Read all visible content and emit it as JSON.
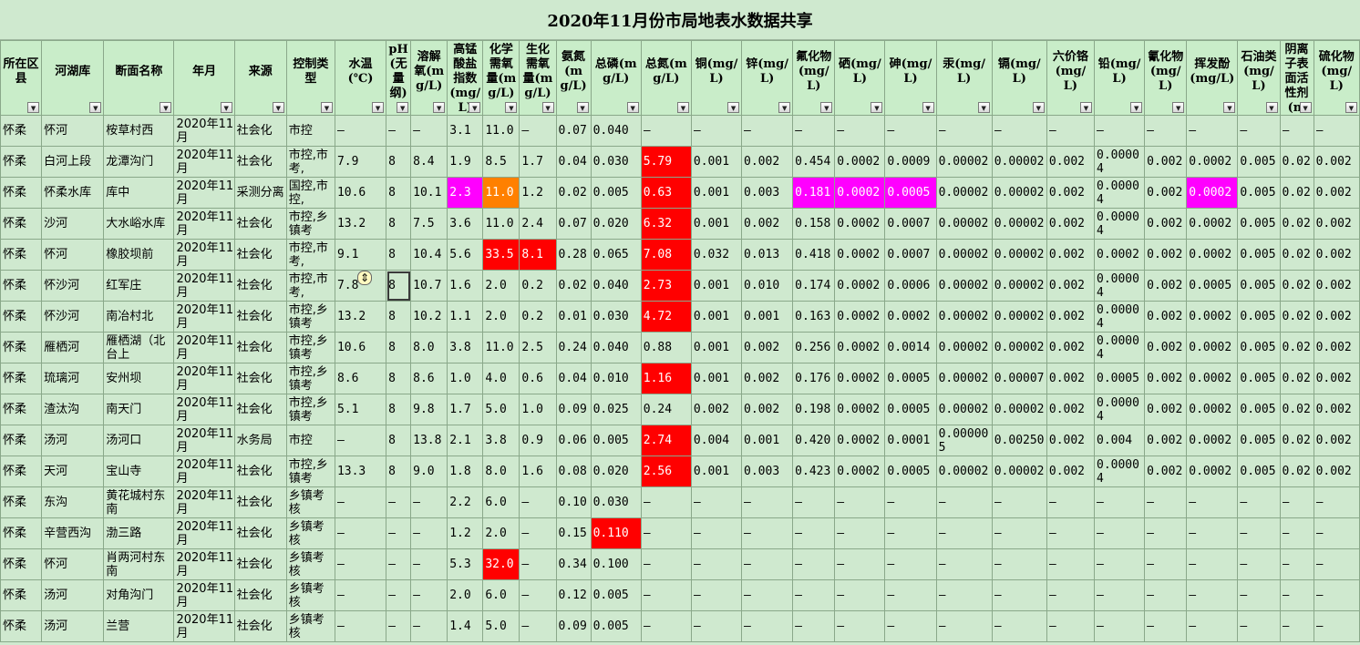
{
  "title": "2020年11月份市局地表水数据共享",
  "columns": [
    {
      "label": "所在区县",
      "width": 45
    },
    {
      "label": "河湖库",
      "width": 68
    },
    {
      "label": "断面名称",
      "width": 77
    },
    {
      "label": "年月",
      "width": 66
    },
    {
      "label": "来源",
      "width": 57
    },
    {
      "label": "控制类型",
      "width": 53
    },
    {
      "label": "水温(℃)",
      "width": 56
    },
    {
      "label": "pH(无量纲)",
      "width": 27
    },
    {
      "label": "溶解氧(mg/L)",
      "width": 40
    },
    {
      "label": "高锰酸盐指数(mg/L)",
      "width": 39
    },
    {
      "label": "化学需氧量(mg/L)",
      "width": 40
    },
    {
      "label": "生化需氧量(mg/L)",
      "width": 40
    },
    {
      "label": "氨氮(mg/L)",
      "width": 38
    },
    {
      "label": "总磷(mg/L)",
      "width": 55
    },
    {
      "label": "总氮(mg/L)",
      "width": 55
    },
    {
      "label": "铜(mg/L)",
      "width": 55
    },
    {
      "label": "锌(mg/L)",
      "width": 56
    },
    {
      "label": "氟化物(mg/L)",
      "width": 46
    },
    {
      "label": "硒(mg/L)",
      "width": 55
    },
    {
      "label": "砷(mg/L)",
      "width": 56
    },
    {
      "label": "汞(mg/L)",
      "width": 61
    },
    {
      "label": "镉(mg/L)",
      "width": 60
    },
    {
      "label": "六价铬(mg/L)",
      "width": 52
    },
    {
      "label": "铅(mg/L)",
      "width": 55
    },
    {
      "label": "氰化物(mg/L)",
      "width": 46
    },
    {
      "label": "挥发酚(mg/L)",
      "width": 56
    },
    {
      "label": "石油类(mg/L)",
      "width": 46
    },
    {
      "label": "阴离子表面活性剂(mg/L)",
      "width": 37
    },
    {
      "label": "硫化物(mg/L)",
      "width": 50
    }
  ],
  "filter_icon": "dropdown-arrow-icon",
  "highlight_colors": {
    "red": "#ff0000",
    "magenta": "#ff00ff",
    "orange": "#ff8000"
  },
  "rows": [
    {
      "cells": [
        "怀柔",
        "怀河",
        "桉草村西",
        "2020年11月",
        "社会化",
        "市控",
        "–",
        "–",
        "–",
        "3.1",
        "11.0",
        "–",
        "0.07",
        "0.040",
        "–",
        "–",
        "–",
        "–",
        "–",
        "–",
        "–",
        "–",
        "–",
        "–",
        "–",
        "–",
        "–",
        "–",
        "–"
      ],
      "hl": {}
    },
    {
      "cells": [
        "怀柔",
        "白河上段",
        "龙潭沟门",
        "2020年11月",
        "社会化",
        "市控,市考,",
        "7.9",
        "8",
        "8.4",
        "1.9",
        "8.5",
        "1.7",
        "0.04",
        "0.030",
        "5.79",
        "0.001",
        "0.002",
        "0.454",
        "0.0002",
        "0.0009",
        "0.00002",
        "0.00002",
        "0.002",
        "0.00004",
        "0.002",
        "0.0002",
        "0.005",
        "0.02",
        "0.002"
      ],
      "hl": {
        "14": "red"
      }
    },
    {
      "cells": [
        "怀柔",
        "怀柔水库",
        "库中",
        "2020年11月",
        "采测分离",
        "国控,市控,",
        "10.6",
        "8",
        "10.1",
        "2.3",
        "11.0",
        "1.2",
        "0.02",
        "0.005",
        "0.63",
        "0.001",
        "0.003",
        "0.181",
        "0.0002",
        "0.0005",
        "0.00002",
        "0.00002",
        "0.002",
        "0.00004",
        "0.002",
        "0.0002",
        "0.005",
        "0.02",
        "0.002"
      ],
      "hl": {
        "9": "mag",
        "10": "org",
        "14": "red",
        "17": "mag",
        "18": "mag",
        "19": "mag",
        "25": "mag"
      }
    },
    {
      "cells": [
        "怀柔",
        "沙河",
        "大水峪水库",
        "2020年11月",
        "社会化",
        "市控,乡镇考",
        "13.2",
        "8",
        "7.5",
        "3.6",
        "11.0",
        "2.4",
        "0.07",
        "0.020",
        "6.32",
        "0.001",
        "0.002",
        "0.158",
        "0.0002",
        "0.0007",
        "0.00002",
        "0.00002",
        "0.002",
        "0.00004",
        "0.002",
        "0.0002",
        "0.005",
        "0.02",
        "0.002"
      ],
      "hl": {
        "14": "red"
      }
    },
    {
      "cells": [
        "怀柔",
        "怀河",
        "橡胶坝前",
        "2020年11月",
        "社会化",
        "市控,市考,",
        "9.1",
        "8",
        "10.4",
        "5.6",
        "33.5",
        "8.1",
        "0.28",
        "0.065",
        "7.08",
        "0.032",
        "0.013",
        "0.418",
        "0.0002",
        "0.0007",
        "0.00002",
        "0.00002",
        "0.002",
        "0.0002",
        "0.002",
        "0.0002",
        "0.005",
        "0.02",
        "0.002"
      ],
      "hl": {
        "10": "red",
        "11": "red",
        "14": "red"
      }
    },
    {
      "cells": [
        "怀柔",
        "怀沙河",
        "红军庄",
        "2020年11月",
        "社会化",
        "市控,市考,",
        "7.8",
        "8",
        "10.7",
        "1.6",
        "2.0",
        "0.2",
        "0.02",
        "0.040",
        "2.73",
        "0.001",
        "0.010",
        "0.174",
        "0.0002",
        "0.0006",
        "0.00002",
        "0.00002",
        "0.002",
        "0.00004",
        "0.002",
        "0.0005",
        "0.005",
        "0.02",
        "0.002"
      ],
      "hl": {
        "14": "red"
      }
    },
    {
      "cells": [
        "怀柔",
        "怀沙河",
        "南冶村北",
        "2020年11月",
        "社会化",
        "市控,乡镇考",
        "13.2",
        "8",
        "10.2",
        "1.1",
        "2.0",
        "0.2",
        "0.01",
        "0.030",
        "4.72",
        "0.001",
        "0.001",
        "0.163",
        "0.0002",
        "0.0002",
        "0.00002",
        "0.00002",
        "0.002",
        "0.00004",
        "0.002",
        "0.0002",
        "0.005",
        "0.02",
        "0.002"
      ],
      "hl": {
        "14": "red"
      }
    },
    {
      "cells": [
        "怀柔",
        "雁栖河",
        "雁栖湖（北台上",
        "2020年11月",
        "社会化",
        "市控,乡镇考",
        "10.6",
        "8",
        "8.0",
        "3.8",
        "11.0",
        "2.5",
        "0.24",
        "0.040",
        "0.88",
        "0.001",
        "0.002",
        "0.256",
        "0.0002",
        "0.0014",
        "0.00002",
        "0.00002",
        "0.002",
        "0.00004",
        "0.002",
        "0.0002",
        "0.005",
        "0.02",
        "0.002"
      ],
      "hl": {}
    },
    {
      "cells": [
        "怀柔",
        "琉璃河",
        "安州坝",
        "2020年11月",
        "社会化",
        "市控,乡镇考",
        "8.6",
        "8",
        "8.6",
        "1.0",
        "4.0",
        "0.6",
        "0.04",
        "0.010",
        "1.16",
        "0.001",
        "0.002",
        "0.176",
        "0.0002",
        "0.0005",
        "0.00002",
        "0.00007",
        "0.002",
        "0.0005",
        "0.002",
        "0.0002",
        "0.005",
        "0.02",
        "0.002"
      ],
      "hl": {
        "14": "red"
      }
    },
    {
      "cells": [
        "怀柔",
        "渣汰沟",
        "南天门",
        "2020年11月",
        "社会化",
        "市控,乡镇考",
        "5.1",
        "8",
        "9.8",
        "1.7",
        "5.0",
        "1.0",
        "0.09",
        "0.025",
        "0.24",
        "0.002",
        "0.002",
        "0.198",
        "0.0002",
        "0.0005",
        "0.00002",
        "0.00002",
        "0.002",
        "0.00004",
        "0.002",
        "0.0002",
        "0.005",
        "0.02",
        "0.002"
      ],
      "hl": {}
    },
    {
      "cells": [
        "怀柔",
        "汤河",
        "汤河口",
        "2020年11月",
        "水务局",
        "市控",
        "–",
        "8",
        "13.8",
        "2.1",
        "3.8",
        "0.9",
        "0.06",
        "0.005",
        "2.74",
        "0.004",
        "0.001",
        "0.420",
        "0.0002",
        "0.0001",
        "0.000005",
        "0.00250",
        "0.002",
        "0.004",
        "0.002",
        "0.0002",
        "0.005",
        "0.02",
        "0.002"
      ],
      "hl": {
        "14": "red"
      }
    },
    {
      "cells": [
        "怀柔",
        "天河",
        "宝山寺",
        "2020年11月",
        "社会化",
        "市控,乡镇考",
        "13.3",
        "8",
        "9.0",
        "1.8",
        "8.0",
        "1.6",
        "0.08",
        "0.020",
        "2.56",
        "0.001",
        "0.003",
        "0.423",
        "0.0002",
        "0.0005",
        "0.00002",
        "0.00002",
        "0.002",
        "0.00004",
        "0.002",
        "0.0002",
        "0.005",
        "0.02",
        "0.002"
      ],
      "hl": {
        "14": "red"
      }
    },
    {
      "cells": [
        "怀柔",
        "东沟",
        "黄花城村东南",
        "2020年11月",
        "社会化",
        "乡镇考核",
        "–",
        "–",
        "–",
        "2.2",
        "6.0",
        "–",
        "0.10",
        "0.030",
        "–",
        "–",
        "–",
        "–",
        "–",
        "–",
        "–",
        "–",
        "–",
        "–",
        "–",
        "–",
        "–",
        "–",
        "–"
      ],
      "hl": {}
    },
    {
      "cells": [
        "怀柔",
        "辛营西沟",
        "渤三路",
        "2020年11月",
        "社会化",
        "乡镇考核",
        "–",
        "–",
        "–",
        "1.2",
        "2.0",
        "–",
        "0.15",
        "0.110",
        "–",
        "–",
        "–",
        "–",
        "–",
        "–",
        "–",
        "–",
        "–",
        "–",
        "–",
        "–",
        "–",
        "–",
        "–"
      ],
      "hl": {
        "13": "red"
      }
    },
    {
      "cells": [
        "怀柔",
        "怀河",
        "肖两河村东南",
        "2020年11月",
        "社会化",
        "乡镇考核",
        "–",
        "–",
        "–",
        "5.3",
        "32.0",
        "–",
        "0.34",
        "0.100",
        "–",
        "–",
        "–",
        "–",
        "–",
        "–",
        "–",
        "–",
        "–",
        "–",
        "–",
        "–",
        "–",
        "–",
        "–"
      ],
      "hl": {
        "10": "red"
      }
    },
    {
      "cells": [
        "怀柔",
        "汤河",
        "对角沟门",
        "2020年11月",
        "社会化",
        "乡镇考核",
        "–",
        "–",
        "–",
        "2.0",
        "6.0",
        "–",
        "0.12",
        "0.005",
        "–",
        "–",
        "–",
        "–",
        "–",
        "–",
        "–",
        "–",
        "–",
        "–",
        "–",
        "–",
        "–",
        "–",
        "–"
      ],
      "hl": {}
    },
    {
      "cells": [
        "怀柔",
        "汤河",
        "兰营",
        "2020年11月",
        "社会化",
        "乡镇考核",
        "–",
        "–",
        "–",
        "1.4",
        "5.0",
        "–",
        "0.09",
        "0.005",
        "–",
        "–",
        "–",
        "–",
        "–",
        "–",
        "–",
        "–",
        "–",
        "–",
        "–",
        "–",
        "–",
        "–",
        "–"
      ],
      "hl": {}
    }
  ]
}
